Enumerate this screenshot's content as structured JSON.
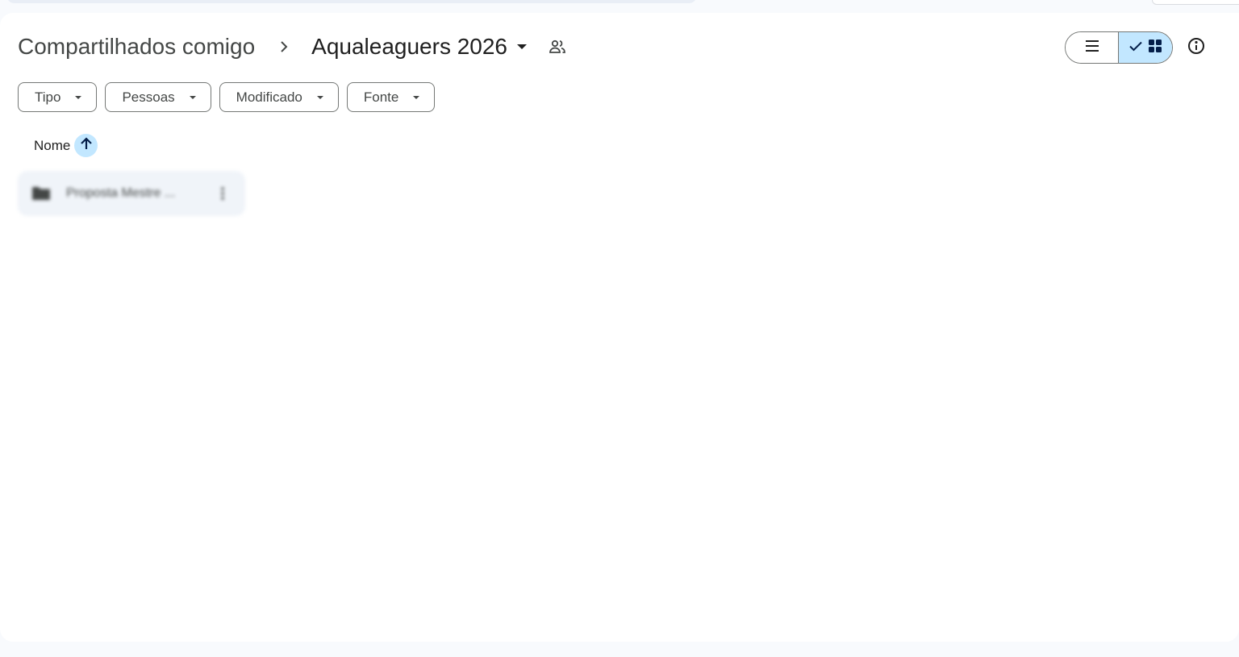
{
  "breadcrumb": {
    "parent": "Compartilhados comigo",
    "current": "Aqualeaguers 2026"
  },
  "icons": {
    "separator": "chevron-right-icon",
    "caret": "caret-down-icon",
    "shared": "people-icon",
    "list_view": "list-view-icon",
    "grid_view": "grid-view-icon",
    "selected": "check-icon",
    "info": "info-icon",
    "sort": "arrow-up-icon",
    "folder": "folder-icon",
    "more": "more-vert-icon"
  },
  "view_toggle": {
    "selected": "grid"
  },
  "filters": [
    {
      "label": "Tipo"
    },
    {
      "label": "Pessoas"
    },
    {
      "label": "Modificado"
    },
    {
      "label": "Fonte"
    }
  ],
  "sort": {
    "label": "Nome",
    "direction": "ascending"
  },
  "items": [
    {
      "name": "Proposta Mestre ...",
      "type": "folder"
    }
  ],
  "colors": {
    "selected_bg": "#c2e7ff",
    "panel_bg": "#ffffff",
    "page_bg": "#f8fafd",
    "outline": "#747775",
    "text_primary": "#1f1f1f",
    "text_secondary": "#444746"
  }
}
